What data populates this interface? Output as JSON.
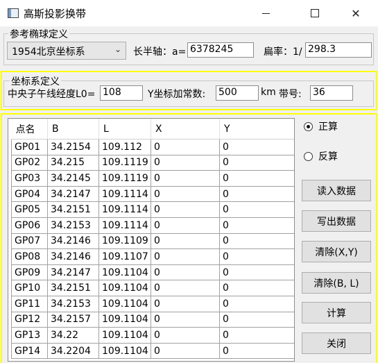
{
  "window": {
    "title": "高斯投影换带"
  },
  "ellipsoid": {
    "legend": "参考椭球定义",
    "selected": "1954北京坐标系",
    "semi_major_label": "长半轴：a=",
    "semi_major_value": "6378245",
    "flattening_label": "扁率：1/",
    "flattening_value": "298.3"
  },
  "coordsys": {
    "legend": "坐标系定义",
    "meridian_label": "中央子午线经度L0=",
    "meridian_value": "108",
    "y_add_label": "Y坐标加常数:",
    "y_add_value": "500",
    "km_label": "km",
    "zone_label": "带号:",
    "zone_value": "36"
  },
  "table": {
    "columns": [
      "点名",
      "B",
      "L",
      "X",
      "Y"
    ],
    "rows": [
      [
        "GP01",
        "34.2154",
        "109.112",
        "0",
        "0"
      ],
      [
        "GP02",
        "34.215",
        "109.1119",
        "0",
        "0"
      ],
      [
        "GP03",
        "34.2145",
        "109.1119",
        "0",
        "0"
      ],
      [
        "GP04",
        "34.2147",
        "109.1114",
        "0",
        "0"
      ],
      [
        "GP05",
        "34.2151",
        "109.1114",
        "0",
        "0"
      ],
      [
        "GP06",
        "34.2153",
        "109.1114",
        "0",
        "0"
      ],
      [
        "GP07",
        "34.2146",
        "109.1109",
        "0",
        "0"
      ],
      [
        "GP08",
        "34.2146",
        "109.1107",
        "0",
        "0"
      ],
      [
        "GP09",
        "34.2147",
        "109.1104",
        "0",
        "0"
      ],
      [
        "GP10",
        "34.2151",
        "109.1104",
        "0",
        "0"
      ],
      [
        "GP11",
        "34.2153",
        "109.1104",
        "0",
        "0"
      ],
      [
        "GP12",
        "34.2157",
        "109.1104",
        "0",
        "0"
      ],
      [
        "GP13",
        "34.22",
        "109.1104",
        "0",
        "0"
      ],
      [
        "GP14",
        "34.2204",
        "109.1104",
        "0",
        "0"
      ]
    ]
  },
  "mode": {
    "forward_label": "正算",
    "inverse_label": "反算",
    "selected": "forward"
  },
  "buttons": {
    "read": "读入数据",
    "write": "写出数据",
    "clear_xy": "清除(X,Y)",
    "clear_bl": "清除(B, L)",
    "compute": "计算",
    "close": "关闭"
  },
  "colors": {
    "highlight_border": "#ffff00",
    "window_bg": "#f0f0f0"
  }
}
